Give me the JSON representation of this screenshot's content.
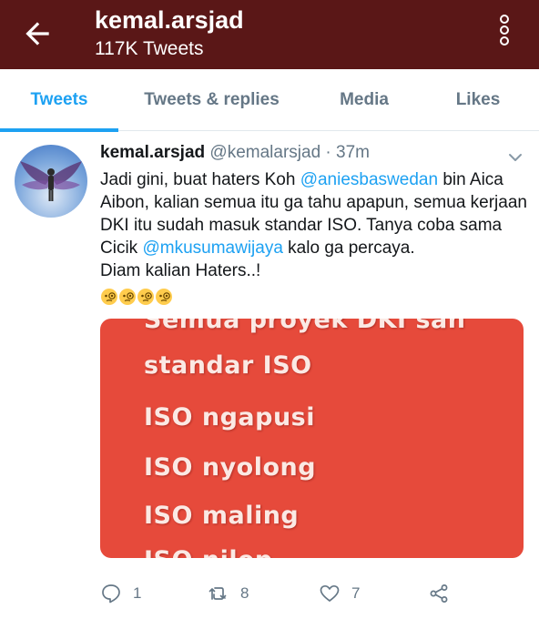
{
  "header": {
    "title": "kemal.arsjad",
    "subtitle": "117K Tweets",
    "bg_color": "#5a1717"
  },
  "tabs": [
    {
      "label": "Tweets",
      "active": true
    },
    {
      "label": "Tweets & replies",
      "active": false
    },
    {
      "label": "Media",
      "active": false
    },
    {
      "label": "Likes",
      "active": false
    }
  ],
  "tweet": {
    "name": "kemal.arsjad",
    "handle": "@kemalarsjad",
    "separator": "·",
    "time": "37m",
    "text_1": "Jadi gini, buat haters Koh ",
    "mention_1": "@aniesbaswedan",
    "text_2": " bin Aica Aibon, kalian semua itu ga tahu apapun, semua kerjaan DKI itu sudah masuk standar ISO. Tanya coba sama Cicik ",
    "mention_2": "@mkusumawijaya",
    "text_3": " kalo ga percaya.",
    "text_4": "Diam kalian Haters..!",
    "emojis": [
      "face-with-monocle",
      "face-with-monocle",
      "face-with-monocle",
      "face-with-monocle"
    ],
    "media": {
      "bg_color": "#e64a3b",
      "cut_top": "Semua proyek DKI sah",
      "lines": [
        "standar ISO",
        "ISO ngapusi",
        "ISO nyolong",
        "ISO maling"
      ],
      "cut_bottom": "ISO nilep"
    },
    "actions": {
      "reply_count": "1",
      "retweet_count": "8",
      "like_count": "7"
    }
  },
  "colors": {
    "accent": "#1da1f2",
    "muted": "#657786"
  }
}
